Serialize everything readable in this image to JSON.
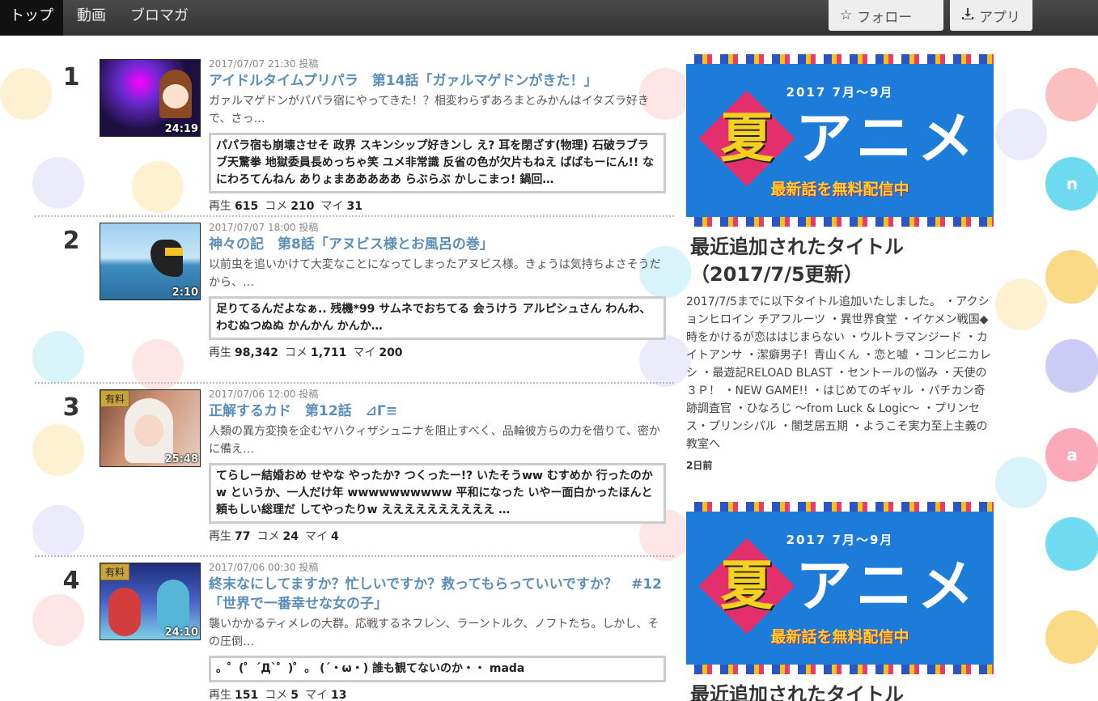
{
  "nav": {
    "tabs": [
      {
        "label": "トップ"
      },
      {
        "label": "動画"
      },
      {
        "label": "ブロマガ"
      }
    ],
    "follow_label": "フォロー",
    "app_label": "アプリ"
  },
  "items": [
    {
      "rank": "1",
      "date": "2017/07/07 21:30 投稿",
      "title": "アイドルタイムプリパラ　第14話「ガァルマゲドンがきた！」",
      "desc": "ガァルマゲドンがパパラ宿にやってきた！？相変わらずあろまとみかんはイタズラ好きで、さっ…",
      "comments": "パパラ宿も崩壊させそ 政界 スキンシップ好きンし え? 耳を閉ざす(物理) 石破ラブラブ天驚拳 地獄委員長めっちゃ笑 ユメ非常識 反省の色が欠片もねえ ばばもーにん!! なにわろてんねん ありょまあああああ らぶらぶ かしこまっ! 鍋回…",
      "duration": "24:19",
      "paid": "",
      "stat_play_label": "再生",
      "stat_play": "615",
      "stat_comment_label": "コメ",
      "stat_comment": "210",
      "stat_mylist_label": "マイ",
      "stat_mylist": "31"
    },
    {
      "rank": "2",
      "date": "2017/07/07 18:00 投稿",
      "title": "神々の記　第8話「アヌビス様とお風呂の巻」",
      "desc": "以前虫を追いかけて大変なことになってしまったアヌビス様。きょうは気持ちよさそうだから、…",
      "comments": "足りてるんだよなぁ.. 残機*99 サムネでおちてる 会うけう アルピシュさん わんわ、わむぬつぬぬ かんかん かんか…",
      "duration": "2:10",
      "paid": "",
      "stat_play_label": "再生",
      "stat_play": "98,342",
      "stat_comment_label": "コメ",
      "stat_comment": "1,711",
      "stat_mylist_label": "マイ",
      "stat_mylist": "200"
    },
    {
      "rank": "3",
      "date": "2017/07/06 12:00 投稿",
      "title": "正解するカド　第12話　⊿Γ≡",
      "desc": "人類の異方変換を企むヤハクィザシュニナを阻止すべく、品輪彼方らの力を借りて、密かに備え…",
      "comments": "てらしー結婚おめ せやな やったか? つくったー!? いたそうww むすめか 行ったのかw というか、一人だけ年 wwwwwwwwww 平和になった いやー面白かったほんと頼もしい総理だ してやったりw ええええええええええ …",
      "duration": "25:48",
      "paid": "有料",
      "stat_play_label": "再生",
      "stat_play": "77",
      "stat_comment_label": "コメ",
      "stat_comment": "24",
      "stat_mylist_label": "マイ",
      "stat_mylist": "4"
    },
    {
      "rank": "4",
      "date": "2017/07/06 00:30 投稿",
      "title": "終末なにしてますか？忙しいですか？救ってもらっていいですか？　#12「世界で一番幸せな女の子」",
      "desc": "襲いかかるティメレの大群。応戦するネフレン、ラーントルク、ノフトたち。しかし、その圧倒…",
      "comments": "。゜(゜´Д`゜)゜。 (´・ω・) 誰も観てないのか・・ mada",
      "duration": "24:10",
      "paid": "有料",
      "stat_play_label": "再生",
      "stat_play": "151",
      "stat_comment_label": "コメ",
      "stat_comment": "5",
      "stat_mylist_label": "マイ",
      "stat_mylist": "13"
    }
  ],
  "side": {
    "banner": {
      "season": "2017 7月～9月",
      "natsu": "夏",
      "anime": "アニメ",
      "free": "最新話を無料配信中"
    },
    "article_title": "最近追加されたタイトル（2017/7/5更新）",
    "article_text": "2017/7/5までに以下タイトル追加いたしました。 ・アクションヒロイン チアフルーツ ・異世界食堂 ・イケメン戦国◆時をかけるが恋ははじまらない ・ウルトラマンジード ・カイトアンサ ・潔癖男子！青山くん ・恋と嘘 ・コンビニカレシ ・最遊記RELOAD BLAST ・セントールの悩み ・天使の３Ｐ！ ・NEW GAME!! ・はじめてのギャル ・パチカン奇跡調査官 ・ひなろじ 〜from Luck & Logic〜 ・プリンセス・プリンシパル ・闇芝居五期 ・ようこそ実力至上主義の教室へ",
    "article_date": "2日前",
    "article2_title": "最近追加されたタイトル"
  },
  "colors": {
    "title_link": "#5b8fb9",
    "nav_bg": "#3a3a3a",
    "banner_bg": "#1d7bd9",
    "paid_badge": "#c9a43c"
  }
}
